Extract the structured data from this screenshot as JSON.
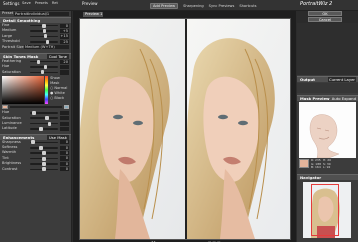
{
  "top": {
    "left_label": "Settings",
    "menu_items": [
      "Save",
      "Presets",
      "Ret",
      "Preview"
    ],
    "preview_label": "Preview",
    "add_preview": "Add Preview",
    "sharpening": "Sharpening",
    "sync_previews": "Sync Previews",
    "shortcuts": "Shortcuts",
    "logo": "PortraitWiz 2",
    "ok": "OK",
    "cancel": "Cancel"
  },
  "left": {
    "preset_label": "Preset",
    "preset_value": "PortraitIndividual/1",
    "detail_head": "Detail Smoothing",
    "detail_sliders": [
      {
        "label": "Fine",
        "value": "0",
        "pos": 0.5
      },
      {
        "label": "Medium",
        "value": "+5",
        "pos": 0.52
      },
      {
        "label": "Large",
        "value": "+15",
        "pos": 0.56
      },
      {
        "label": "Threshold",
        "value": "25",
        "pos": 0.62
      }
    ],
    "portrait_size_label": "Portrait Size",
    "portrait_size_value": "Medium (W+TH)",
    "skin_head": "Skin Tones Mask",
    "skin_dropdown": "Cool Tone",
    "skin_sliders": [
      {
        "label": "Feathering",
        "value": "20",
        "pos": 0.3
      },
      {
        "label": "Hue",
        "value": "",
        "pos": 0.55
      },
      {
        "label": "Saturation",
        "value": "",
        "pos": 0.45
      }
    ],
    "show_mask_label": "Show Mask",
    "mask_options": [
      "Normal",
      "White",
      "Black"
    ],
    "latitude_sliders": [
      {
        "label": "Hue",
        "value": "",
        "pos": 0.15
      },
      {
        "label": "Saturation",
        "value": "",
        "pos": 0.6
      },
      {
        "label": "Luminance",
        "value": "",
        "pos": 0.7
      },
      {
        "label": "Latitude",
        "value": "",
        "pos": 0.4
      }
    ],
    "enh_head": "Enhancements",
    "enh_button": "Use Mask",
    "enh_sliders": [
      {
        "label": "Sharpness",
        "value": "0",
        "pos": 0.1
      },
      {
        "label": "Softness",
        "value": "0",
        "pos": 0.4
      },
      {
        "label": "Warmth",
        "value": "0",
        "pos": 0.5
      },
      {
        "label": "Tint",
        "value": "0",
        "pos": 0.5
      },
      {
        "label": "Brightness",
        "value": "0",
        "pos": 0.5
      },
      {
        "label": "Contrast",
        "value": "0",
        "pos": 0.5
      }
    ]
  },
  "center": {
    "tab_label": "Preview 1",
    "bottom_left": "◂ ▸",
    "bottom_right": "▭ ▭ ▭"
  },
  "right": {
    "output_head": "Output",
    "output_value": "Current Layer",
    "mask_head": "Mask Preview",
    "mask_option": "Auto Expand",
    "mask_info": [
      "R: 235",
      "G: 188",
      "B: 164"
    ],
    "mask_info2": [
      "H: 20",
      "S: 30",
      "L: 92"
    ],
    "nav_head": "Navigator"
  },
  "colors": {
    "accent": "#b94a3a",
    "skin_swatch": "#e3b39a",
    "nav_frame": "#e43c3c"
  }
}
